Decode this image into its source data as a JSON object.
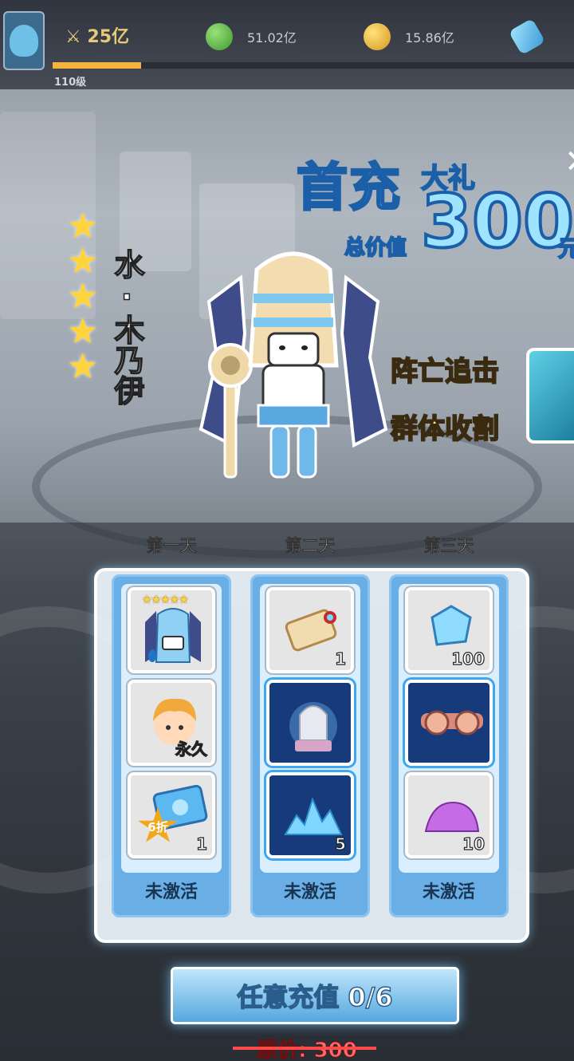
{
  "topbar": {
    "power": "25亿",
    "green_resource": "51.02亿",
    "gold_resource": "15.86亿",
    "level": "110级",
    "xp_progress": 0.17
  },
  "banner": {
    "title": "首充",
    "subtitle": "大礼",
    "total_label": "总价值",
    "value": "300",
    "unit": "元"
  },
  "hero": {
    "star_count": 5,
    "name": "水·木乃伊",
    "skills": [
      "阵亡追击",
      "群体收割"
    ]
  },
  "days": [
    {
      "label": "第一天",
      "status": "未激活",
      "items": [
        {
          "icon": "hero-mummy-icon",
          "mini_stars": "★★★★★",
          "qty": ""
        },
        {
          "icon": "blonde-character-icon",
          "tag": "永久"
        },
        {
          "icon": "discount-card-icon",
          "discount": "6折",
          "qty": "1"
        }
      ]
    },
    {
      "label": "第二天",
      "status": "未激活",
      "items": [
        {
          "icon": "scroll-icon",
          "qty": "1"
        },
        {
          "icon": "lion-statue-icon",
          "qty": ""
        },
        {
          "icon": "crystal-shard-icon",
          "qty": "5"
        }
      ]
    },
    {
      "label": "第三天",
      "status": "未激活",
      "items": [
        {
          "icon": "blue-gem-icon",
          "qty": "100"
        },
        {
          "icon": "goggles-icon",
          "qty": ""
        },
        {
          "icon": "purple-powder-icon",
          "qty": "10"
        }
      ]
    }
  ],
  "recharge": {
    "label": "任意充值 0/6",
    "original_price": "原价: 300"
  },
  "colors": {
    "accent_blue": "#6aaee6",
    "star_gold": "#ffd43b",
    "strike_red": "#ff4a4a"
  }
}
